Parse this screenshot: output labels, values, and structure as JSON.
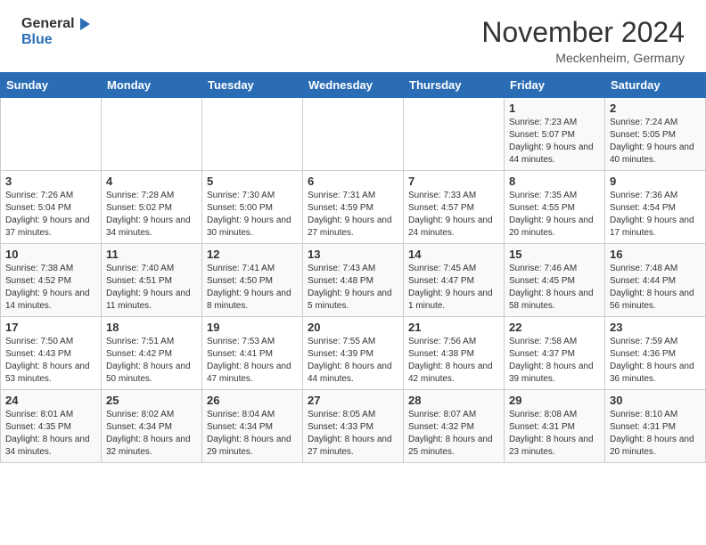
{
  "header": {
    "logo_general": "General",
    "logo_blue": "Blue",
    "month": "November 2024",
    "location": "Meckenheim, Germany"
  },
  "weekdays": [
    "Sunday",
    "Monday",
    "Tuesday",
    "Wednesday",
    "Thursday",
    "Friday",
    "Saturday"
  ],
  "weeks": [
    [
      {
        "day": "",
        "info": ""
      },
      {
        "day": "",
        "info": ""
      },
      {
        "day": "",
        "info": ""
      },
      {
        "day": "",
        "info": ""
      },
      {
        "day": "",
        "info": ""
      },
      {
        "day": "1",
        "info": "Sunrise: 7:23 AM\nSunset: 5:07 PM\nDaylight: 9 hours and 44 minutes."
      },
      {
        "day": "2",
        "info": "Sunrise: 7:24 AM\nSunset: 5:05 PM\nDaylight: 9 hours and 40 minutes."
      }
    ],
    [
      {
        "day": "3",
        "info": "Sunrise: 7:26 AM\nSunset: 5:04 PM\nDaylight: 9 hours and 37 minutes."
      },
      {
        "day": "4",
        "info": "Sunrise: 7:28 AM\nSunset: 5:02 PM\nDaylight: 9 hours and 34 minutes."
      },
      {
        "day": "5",
        "info": "Sunrise: 7:30 AM\nSunset: 5:00 PM\nDaylight: 9 hours and 30 minutes."
      },
      {
        "day": "6",
        "info": "Sunrise: 7:31 AM\nSunset: 4:59 PM\nDaylight: 9 hours and 27 minutes."
      },
      {
        "day": "7",
        "info": "Sunrise: 7:33 AM\nSunset: 4:57 PM\nDaylight: 9 hours and 24 minutes."
      },
      {
        "day": "8",
        "info": "Sunrise: 7:35 AM\nSunset: 4:55 PM\nDaylight: 9 hours and 20 minutes."
      },
      {
        "day": "9",
        "info": "Sunrise: 7:36 AM\nSunset: 4:54 PM\nDaylight: 9 hours and 17 minutes."
      }
    ],
    [
      {
        "day": "10",
        "info": "Sunrise: 7:38 AM\nSunset: 4:52 PM\nDaylight: 9 hours and 14 minutes."
      },
      {
        "day": "11",
        "info": "Sunrise: 7:40 AM\nSunset: 4:51 PM\nDaylight: 9 hours and 11 minutes."
      },
      {
        "day": "12",
        "info": "Sunrise: 7:41 AM\nSunset: 4:50 PM\nDaylight: 9 hours and 8 minutes."
      },
      {
        "day": "13",
        "info": "Sunrise: 7:43 AM\nSunset: 4:48 PM\nDaylight: 9 hours and 5 minutes."
      },
      {
        "day": "14",
        "info": "Sunrise: 7:45 AM\nSunset: 4:47 PM\nDaylight: 9 hours and 1 minute."
      },
      {
        "day": "15",
        "info": "Sunrise: 7:46 AM\nSunset: 4:45 PM\nDaylight: 8 hours and 58 minutes."
      },
      {
        "day": "16",
        "info": "Sunrise: 7:48 AM\nSunset: 4:44 PM\nDaylight: 8 hours and 56 minutes."
      }
    ],
    [
      {
        "day": "17",
        "info": "Sunrise: 7:50 AM\nSunset: 4:43 PM\nDaylight: 8 hours and 53 minutes."
      },
      {
        "day": "18",
        "info": "Sunrise: 7:51 AM\nSunset: 4:42 PM\nDaylight: 8 hours and 50 minutes."
      },
      {
        "day": "19",
        "info": "Sunrise: 7:53 AM\nSunset: 4:41 PM\nDaylight: 8 hours and 47 minutes."
      },
      {
        "day": "20",
        "info": "Sunrise: 7:55 AM\nSunset: 4:39 PM\nDaylight: 8 hours and 44 minutes."
      },
      {
        "day": "21",
        "info": "Sunrise: 7:56 AM\nSunset: 4:38 PM\nDaylight: 8 hours and 42 minutes."
      },
      {
        "day": "22",
        "info": "Sunrise: 7:58 AM\nSunset: 4:37 PM\nDaylight: 8 hours and 39 minutes."
      },
      {
        "day": "23",
        "info": "Sunrise: 7:59 AM\nSunset: 4:36 PM\nDaylight: 8 hours and 36 minutes."
      }
    ],
    [
      {
        "day": "24",
        "info": "Sunrise: 8:01 AM\nSunset: 4:35 PM\nDaylight: 8 hours and 34 minutes."
      },
      {
        "day": "25",
        "info": "Sunrise: 8:02 AM\nSunset: 4:34 PM\nDaylight: 8 hours and 32 minutes."
      },
      {
        "day": "26",
        "info": "Sunrise: 8:04 AM\nSunset: 4:34 PM\nDaylight: 8 hours and 29 minutes."
      },
      {
        "day": "27",
        "info": "Sunrise: 8:05 AM\nSunset: 4:33 PM\nDaylight: 8 hours and 27 minutes."
      },
      {
        "day": "28",
        "info": "Sunrise: 8:07 AM\nSunset: 4:32 PM\nDaylight: 8 hours and 25 minutes."
      },
      {
        "day": "29",
        "info": "Sunrise: 8:08 AM\nSunset: 4:31 PM\nDaylight: 8 hours and 23 minutes."
      },
      {
        "day": "30",
        "info": "Sunrise: 8:10 AM\nSunset: 4:31 PM\nDaylight: 8 hours and 20 minutes."
      }
    ]
  ]
}
